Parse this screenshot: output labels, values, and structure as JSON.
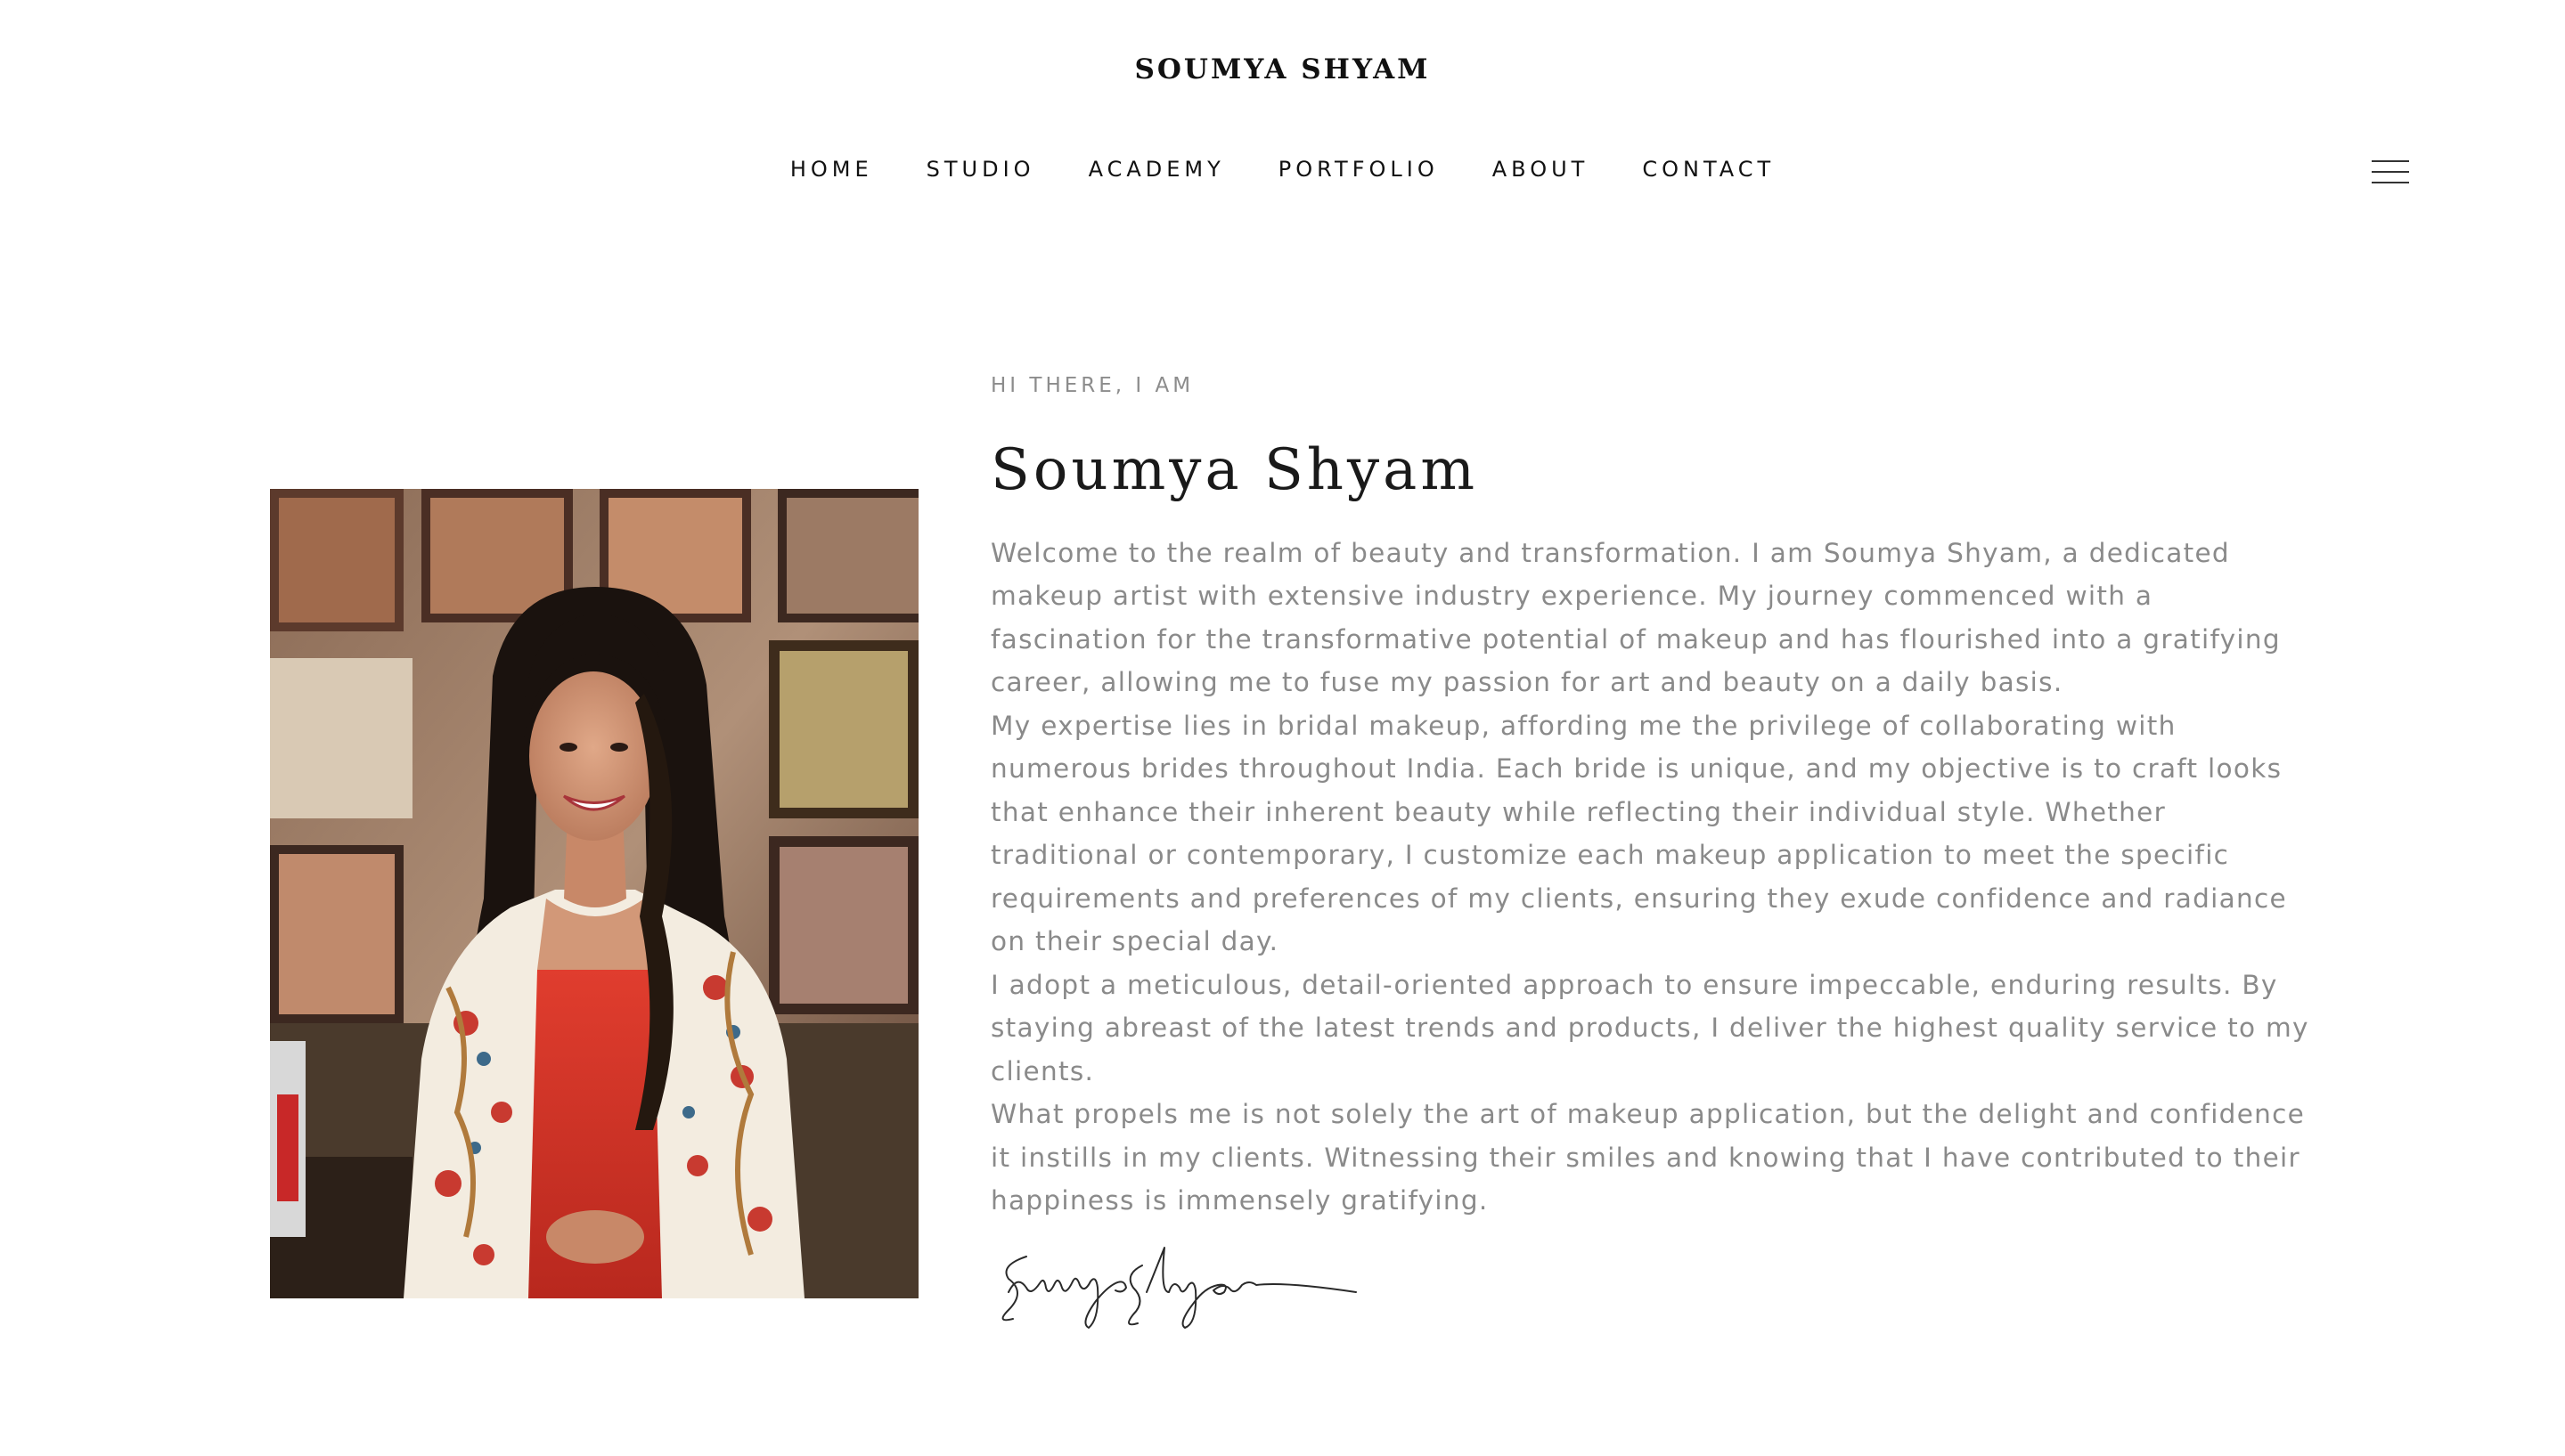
{
  "header": {
    "brand": "SOUMYA SHYAM",
    "nav": [
      "HOME",
      "STUDIO",
      "ACADEMY",
      "PORTFOLIO",
      "ABOUT",
      "CONTACT"
    ]
  },
  "about": {
    "eyebrow": "HI THERE, I AM",
    "name": "Soumya Shyam",
    "paragraphs": [
      "Welcome to the realm of beauty and transformation. I am Soumya Shyam, a dedicated makeup artist with extensive industry experience. My journey commenced with a fascination for the transformative potential of makeup and has flourished into a gratifying career, allowing me to fuse my passion for art and beauty on a daily basis.",
      "My expertise lies in bridal makeup, affording me the privilege of collaborating with numerous brides throughout India. Each bride is unique, and my objective is to craft looks that enhance their inherent beauty while reflecting their individual style. Whether traditional or contemporary, I customize each makeup application to meet the specific requirements and preferences of my clients, ensuring they exude confidence and radiance on their special day.",
      "I adopt a meticulous, detail-oriented approach to ensure impeccable, enduring results. By staying abreast of the latest trends and products, I deliver the highest quality service to my clients.",
      "What propels me is not solely the art of makeup application, but the delight and confidence it instills in my clients. Witnessing their smiles and knowing that I have contributed to their happiness is immensely gratifying."
    ],
    "signature_text": "Soumya Shyam"
  },
  "icons": {
    "menu": "hamburger-menu-icon"
  },
  "colors": {
    "text_dark": "#111111",
    "text_muted": "#8a8a8a",
    "dress_red": "#d8342a"
  }
}
